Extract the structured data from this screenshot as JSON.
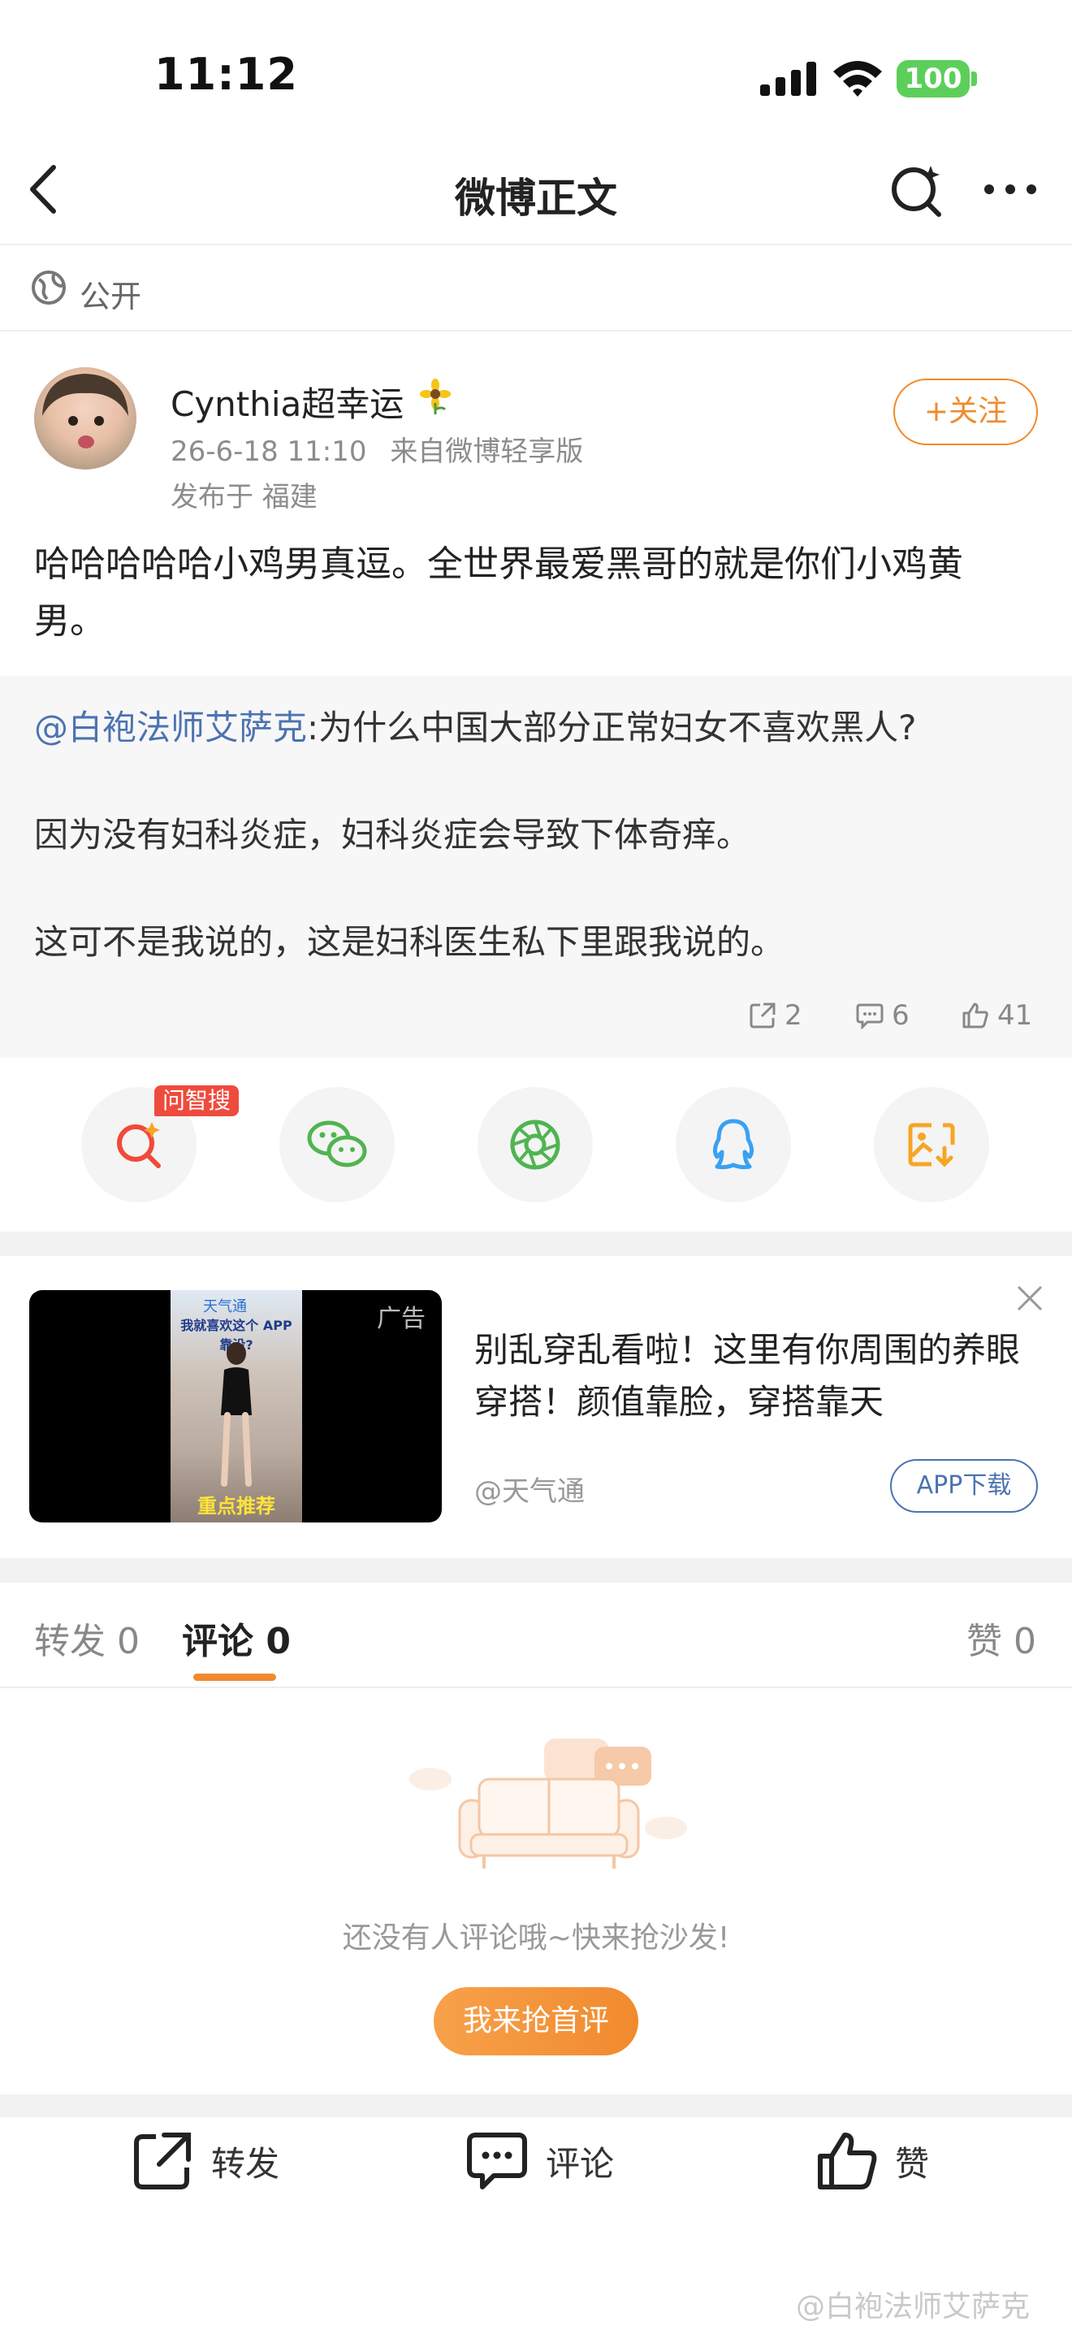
{
  "status_bar": {
    "time": "11:12",
    "battery": "100"
  },
  "nav": {
    "title": "微博正文"
  },
  "visibility": {
    "label": "公开"
  },
  "post": {
    "username": "Cynthia超幸运",
    "timestamp": "26-6-18 11:10",
    "source": "来自微博轻享版",
    "location": "发布于 福建",
    "follow_label": "+关注",
    "text": "哈哈哈哈哈小鸡男真逗。全世界最爱黑哥的就是你们小鸡黄男。"
  },
  "repost": {
    "mention": "@白袍法师艾萨克",
    "line1_rest": ":为什么中国大部分正常妇女不喜欢黑人?",
    "line2": "因为没有妇科炎症，妇科炎症会导致下体奇痒。",
    "line3": "这可不是我说的，这是妇科医生私下里跟我说的。",
    "shares": "2",
    "comments": "6",
    "likes": "41"
  },
  "share_row": {
    "badge": "问智搜"
  },
  "ad": {
    "tag": "广告",
    "text": "别乱穿乱看啦！这里有你周围的养眼穿搭！颜值靠脸，穿搭靠天",
    "source": "@天气通",
    "download_label": "APP下载",
    "banner_top": "天气通",
    "banner_headline": "我就喜欢这个 APP 靠没?",
    "banner_bottom": "重点推荐"
  },
  "tabs": {
    "repost": "转发 0",
    "comment": "评论 0",
    "like": "赞 0"
  },
  "empty_state": {
    "text": "还没有人评论哦~快来抢沙发!",
    "button": "我来抢首评"
  },
  "bottom_bar": {
    "repost": "转发",
    "comment": "评论",
    "like": "赞"
  },
  "watermark": "@白袍法师艾萨克",
  "colors": {
    "accent": "#f18a2e",
    "link": "#4c73b1",
    "battery": "#5ccf5a"
  }
}
